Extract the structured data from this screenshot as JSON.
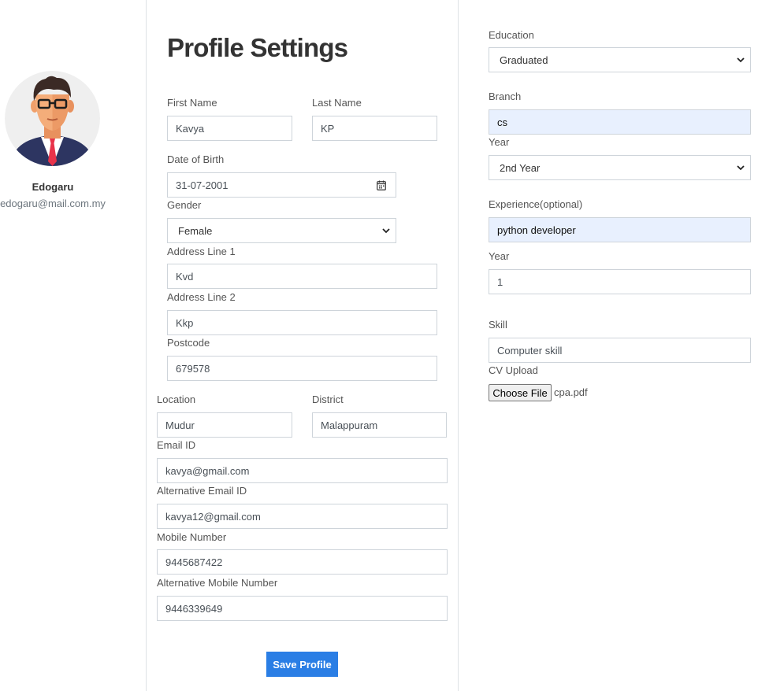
{
  "profile": {
    "name": "Edogaru",
    "email": "edogaru@mail.com.my"
  },
  "title": "Profile Settings",
  "form": {
    "first_name": {
      "label": "First Name",
      "value": "Kavya"
    },
    "last_name": {
      "label": "Last Name",
      "value": "KP"
    },
    "dob": {
      "label": "Date of Birth",
      "value": "31-07-2001"
    },
    "gender": {
      "label": "Gender",
      "value": "Female"
    },
    "address1": {
      "label": "Address Line 1",
      "value": "Kvd"
    },
    "address2": {
      "label": "Address Line 2",
      "value": "Kkp"
    },
    "postcode": {
      "label": "Postcode",
      "value": "679578"
    },
    "location": {
      "label": "Location",
      "value": "Mudur"
    },
    "district": {
      "label": "District",
      "value": "Malappuram"
    },
    "email": {
      "label": "Email ID",
      "value": "kavya@gmail.com"
    },
    "alt_email": {
      "label": "Alternative Email ID",
      "value": "kavya12@gmail.com"
    },
    "mobile": {
      "label": "Mobile Number",
      "value": "9445687422"
    },
    "alt_mobile": {
      "label": "Alternative Mobile Number",
      "value": "9446339649"
    },
    "save_label": "Save Profile"
  },
  "right": {
    "education": {
      "label": "Education",
      "value": "Graduated"
    },
    "branch": {
      "label": "Branch",
      "value": "cs"
    },
    "year": {
      "label": "Year",
      "value": "2nd Year"
    },
    "experience": {
      "label": "Experience(optional)",
      "value": "python developer"
    },
    "exp_year": {
      "label": "Year",
      "value": "1"
    },
    "skill": {
      "label": "Skill",
      "value": "Computer skill"
    },
    "cv": {
      "label": "CV Upload",
      "button": "Choose File",
      "file": "cpa.pdf"
    }
  },
  "colors": {
    "accent": "#2a7ee5",
    "autofill": "#e8f0fe",
    "border": "#ced4da"
  },
  "icons": [
    "avatar",
    "calendar-icon",
    "chevron-down-icon"
  ]
}
